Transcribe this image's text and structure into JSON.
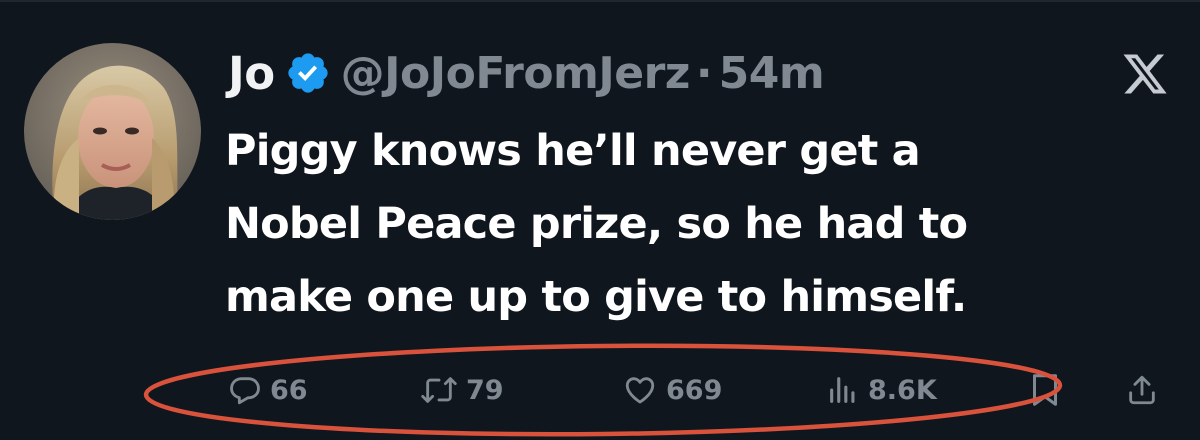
{
  "tweet": {
    "author": {
      "display_name": "Jo",
      "handle": "@JoJoFromJerz",
      "verified": true,
      "avatar": "profile-photo"
    },
    "separator": "·",
    "time": "54m",
    "text_lines": [
      "Piggy knows he’ll never get a",
      "Nobel Peace prize, so he had to",
      "make one up to give to himself."
    ],
    "actions": {
      "replies": "66",
      "retweets": "79",
      "likes": "669",
      "views": "8.6K"
    }
  },
  "icons": {
    "verified": "verified-badge-icon",
    "platform": "x-logo-icon",
    "reply": "reply-icon",
    "retweet": "retweet-icon",
    "like": "heart-icon",
    "views": "views-icon",
    "bookmark": "bookmark-icon",
    "share": "share-icon"
  },
  "colors": {
    "background": "#10161d",
    "text": "#ffffff",
    "muted": "#808991",
    "verified": "#1d9bf0",
    "annotation": "#d9523b"
  }
}
